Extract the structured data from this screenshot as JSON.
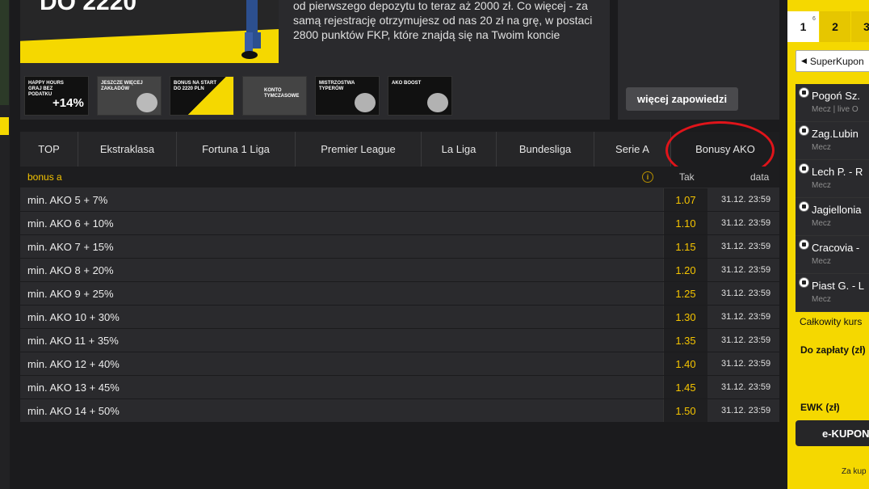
{
  "hero": {
    "headline": "DO 2220",
    "promo_text": "od pierwszego depozytu to teraz aż 2000 zł. Co więcej - za samą rejestrację otrzymujesz od nas 20 zł na grę, w postaci 2800 punktów FKP, które znajdą się na Twoim koncie"
  },
  "thumbs": [
    {
      "title": "Happy hours graj bez podatku",
      "big": "+14%"
    },
    {
      "title": "Jeszcze więcej zakładów",
      "big": ""
    },
    {
      "title": "Bonus na start do 2220 PLN",
      "big": ""
    },
    {
      "title": "Konto tymczasowe",
      "big": ""
    },
    {
      "title": "Mistrzostwa typerów",
      "big": ""
    },
    {
      "title": "AKO boost",
      "big": ""
    }
  ],
  "more_button": "więcej zapowiedzi",
  "tabs": [
    "TOP",
    "Ekstraklasa",
    "Fortuna 1 Liga",
    "Premier League",
    "La Liga",
    "Bundesliga",
    "Serie A",
    "Bonusy AKO"
  ],
  "table": {
    "title": "bonus a",
    "col_odds": "Tak",
    "col_date": "data",
    "rows": [
      {
        "name": "min. AKO 5 + 7%",
        "odds": "1.07",
        "date": "31.12. 23:59"
      },
      {
        "name": "min. AKO 6 + 10%",
        "odds": "1.10",
        "date": "31.12. 23:59"
      },
      {
        "name": "min. AKO 7 + 15%",
        "odds": "1.15",
        "date": "31.12. 23:59"
      },
      {
        "name": "min. AKO 8 + 20%",
        "odds": "1.20",
        "date": "31.12. 23:59"
      },
      {
        "name": "min. AKO 9 + 25%",
        "odds": "1.25",
        "date": "31.12. 23:59"
      },
      {
        "name": "min. AKO 10 + 30%",
        "odds": "1.30",
        "date": "31.12. 23:59"
      },
      {
        "name": "min. AKO 11 + 35%",
        "odds": "1.35",
        "date": "31.12. 23:59"
      },
      {
        "name": "min. AKO 12 + 40%",
        "odds": "1.40",
        "date": "31.12. 23:59"
      },
      {
        "name": "min. AKO 13 + 45%",
        "odds": "1.45",
        "date": "31.12. 23:59"
      },
      {
        "name": "min. AKO 14 + 50%",
        "odds": "1.50",
        "date": "31.12. 23:59"
      }
    ]
  },
  "betslip": {
    "pages": [
      "1",
      "2",
      "3"
    ],
    "page1_count": "6",
    "kupon_type": "SuperKupon",
    "matches": [
      {
        "match": "Pogoń Sz.",
        "sub": "Mecz | live O"
      },
      {
        "match": "Zag.Lubin",
        "sub": "Mecz"
      },
      {
        "match": "Lech P. - R",
        "sub": "Mecz"
      },
      {
        "match": "Jagiellonia",
        "sub": "Mecz"
      },
      {
        "match": "Cracovia -",
        "sub": "Mecz"
      },
      {
        "match": "Piast G. - L",
        "sub": "Mecz"
      }
    ],
    "total_label": "Całkowity kurs",
    "topay_label": "Do zapłaty (zł)",
    "ewk_label": "EWK (zł)",
    "ekupon_button": "e-KUPON",
    "footer": "Za kup"
  },
  "colors": {
    "accent": "#f5d800",
    "highlight_ring": "#e0141a",
    "odds_text": "#f5c400"
  }
}
